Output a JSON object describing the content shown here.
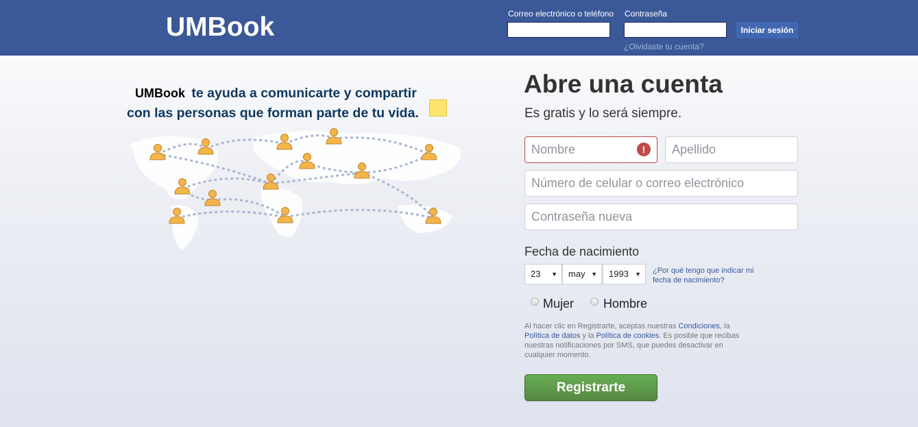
{
  "header": {
    "logo": "UMBook",
    "email_label": "Correo electrónico o teléfono",
    "password_label": "Contraseña",
    "login_button": "Iniciar sesión",
    "forgot_link": "¿Olvidaste tu cuenta?",
    "email_value": "",
    "password_value": ""
  },
  "left": {
    "brand": "UMBook",
    "tagline_1": "te ayuda a comunicarte y compartir",
    "tagline_2": "con las personas que forman parte de tu vida."
  },
  "signup": {
    "title": "Abre una cuenta",
    "subtitle": "Es gratis y lo será siempre.",
    "first_name_placeholder": "Nombre",
    "last_name_placeholder": "Apellido",
    "contact_placeholder": "Número de celular o correo electrónico",
    "password_placeholder": "Contraseña nueva",
    "birthday_label": "Fecha de nacimiento",
    "day": "23",
    "month": "may",
    "year": "1993",
    "why_link": "¿Por qué tengo que indicar mi fecha de nacimiento?",
    "gender_female": "Mujer",
    "gender_male": "Hombre",
    "terms_1": "Al hacer clic en Registrarte, aceptas nuestras ",
    "terms_conditions": "Condiciones",
    "terms_2": ", la ",
    "terms_data_policy": "Política de datos",
    "terms_3": " y la ",
    "terms_cookies": "Política de cookies",
    "terms_4": ". Es posible que recibas nuestras notificaciones por SMS, que puedes desactivar en cualquier momento.",
    "register_button": "Registrarte"
  },
  "colors": {
    "header_bg": "#3b5998",
    "register_green": "#67ae55",
    "error_red": "#be4b49",
    "link_blue": "#365899"
  },
  "icons": [
    "error-icon",
    "person-icon",
    "sticky-note-icon",
    "dropdown-arrow-icon"
  ]
}
